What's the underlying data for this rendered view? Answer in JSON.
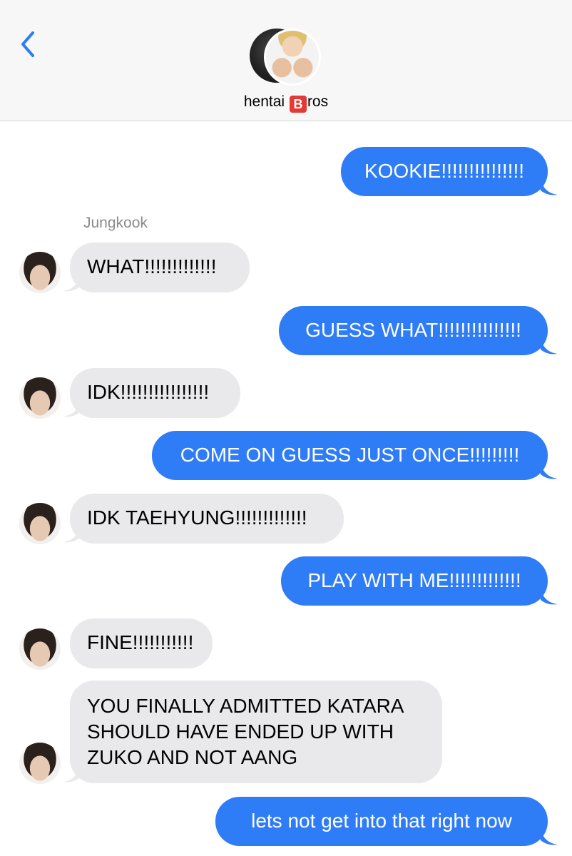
{
  "header": {
    "group_name_prefix": "hentai ",
    "group_name_emoji": "B",
    "group_name_suffix": "ros",
    "back_icon": "chevron-left-icon"
  },
  "sender_label": "Jungkook",
  "colors": {
    "outgoing": "#2e7cf6",
    "incoming": "#e9e9eb",
    "accent": "#2e7cf6"
  },
  "messages": [
    {
      "from": "me",
      "text": "KOOKIE!!!!!!!!!!!!!!!"
    },
    {
      "from": "Jungkook",
      "text": "WHAT!!!!!!!!!!!!!"
    },
    {
      "from": "me",
      "text": "GUESS WHAT!!!!!!!!!!!!!!!"
    },
    {
      "from": "Jungkook",
      "text": "IDK!!!!!!!!!!!!!!!!"
    },
    {
      "from": "me",
      "text": "COME ON GUESS JUST ONCE!!!!!!!!!"
    },
    {
      "from": "Jungkook",
      "text": "IDK TAEHYUNG!!!!!!!!!!!!!"
    },
    {
      "from": "me",
      "text": "PLAY WITH ME!!!!!!!!!!!!!"
    },
    {
      "from": "Jungkook",
      "text": "FINE!!!!!!!!!!!"
    },
    {
      "from": "Jungkook",
      "text": "YOU FINALLY ADMITTED KATARA\nSHOULD HAVE ENDED UP WITH\nZUKO AND NOT AANG"
    },
    {
      "from": "me",
      "text": "lets not get into that right now"
    }
  ]
}
